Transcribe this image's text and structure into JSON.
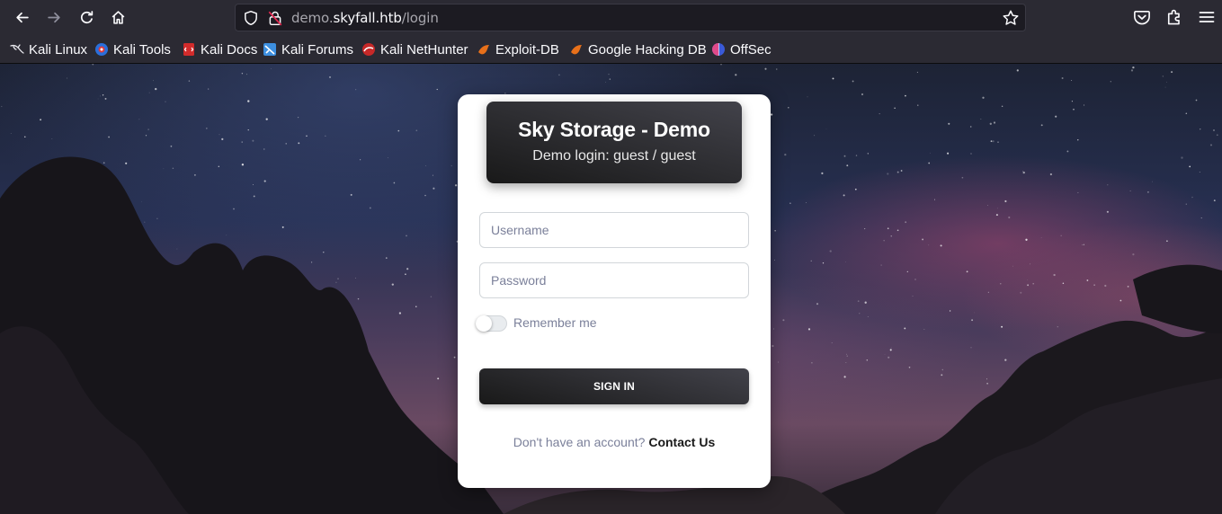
{
  "browser": {
    "url_prefix": "demo.",
    "url_host": "skyfall.htb",
    "url_path": "/login"
  },
  "bookmarks": [
    {
      "label": "Kali Linux",
      "icon": "kali-dragon-icon"
    },
    {
      "label": "Kali Tools",
      "icon": "kali-tools-icon"
    },
    {
      "label": "Kali Docs",
      "icon": "kali-docs-icon"
    },
    {
      "label": "Kali Forums",
      "icon": "kali-forums-icon"
    },
    {
      "label": "Kali NetHunter",
      "icon": "kali-nethunter-icon"
    },
    {
      "label": "Exploit-DB",
      "icon": "exploit-db-icon"
    },
    {
      "label": "Google Hacking DB",
      "icon": "ghdb-icon"
    },
    {
      "label": "OffSec",
      "icon": "offsec-icon"
    }
  ],
  "login": {
    "title": "Sky Storage - Demo",
    "subtitle": "Demo login: guest / guest",
    "username_placeholder": "Username",
    "password_placeholder": "Password",
    "remember_label": "Remember me",
    "remember_checked": false,
    "signin_label": "SIGN IN",
    "footer_text": "Don't have an account?",
    "footer_link": "Contact Us"
  },
  "colors": {
    "browser_chrome": "#2b2a33",
    "urlbar_bg": "#1c1b22",
    "card_header_dark": "#191919",
    "text_muted": "#7b809a"
  }
}
